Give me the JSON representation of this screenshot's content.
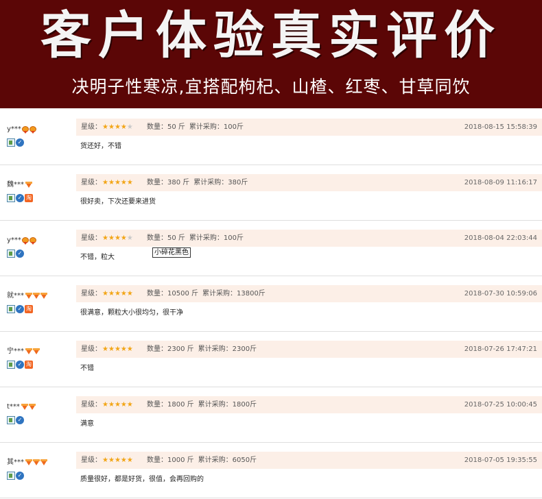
{
  "banner": {
    "title": "客户体验真实评价",
    "subtitle": "决明子性寒凉,宜搭配枸杞、山楂、红枣、甘草同饮"
  },
  "labels": {
    "level": "星级：",
    "qty_prefix": "数量：",
    "total_prefix": "累计采购："
  },
  "tooltip": "小碎花黑色",
  "reviews": [
    {
      "user": "y***",
      "medals": [
        "crown",
        "crown"
      ],
      "badges": [
        "id",
        "check"
      ],
      "stars": 4,
      "qty": "50 斤",
      "total": "100斤",
      "date": "2018-08-15 15:58:39",
      "comment": "货还好，不错"
    },
    {
      "user": "魏***",
      "medals": [
        "diamond"
      ],
      "badges": [
        "id",
        "check",
        "tao"
      ],
      "stars": 5,
      "qty": "380 斤",
      "total": "380斤",
      "date": "2018-08-09 11:16:17",
      "comment": "很好卖，下次还要来进货"
    },
    {
      "user": "y***",
      "medals": [
        "crown",
        "crown"
      ],
      "badges": [
        "id",
        "check"
      ],
      "stars": 4,
      "qty": "50 斤",
      "total": "100斤",
      "date": "2018-08-04 22:03:44",
      "comment": "不错，粒大"
    },
    {
      "user": "就***",
      "medals": [
        "diamond",
        "diamond",
        "diamond"
      ],
      "badges": [
        "id",
        "check",
        "tao"
      ],
      "stars": 5,
      "qty": "10500 斤",
      "total": "13800斤",
      "date": "2018-07-30 10:59:06",
      "comment": "很满意，颗粒大小很均匀，很干净"
    },
    {
      "user": "宁***",
      "medals": [
        "diamond",
        "diamond"
      ],
      "badges": [
        "id",
        "check",
        "tao"
      ],
      "stars": 5,
      "qty": "2300 斤",
      "total": "2300斤",
      "date": "2018-07-26 17:47:21",
      "comment": "不错"
    },
    {
      "user": "t***",
      "medals": [
        "diamond",
        "diamond"
      ],
      "badges": [
        "id",
        "check"
      ],
      "stars": 5,
      "qty": "1800 斤",
      "total": "1800斤",
      "date": "2018-07-25 10:00:45",
      "comment": "满意"
    },
    {
      "user": "其***",
      "medals": [
        "diamond",
        "diamond",
        "diamond"
      ],
      "badges": [
        "id",
        "check"
      ],
      "stars": 5,
      "qty": "1000 斤",
      "total": "6050斤",
      "date": "2018-07-05 19:35:55",
      "comment": "质量很好，都是好货，很值，会再回购的"
    }
  ],
  "colors": {
    "banner_bg": "#5b0606",
    "meta_bg": "#fcefe7",
    "star_on": "#f2a516",
    "star_off": "#c9c9c9"
  }
}
